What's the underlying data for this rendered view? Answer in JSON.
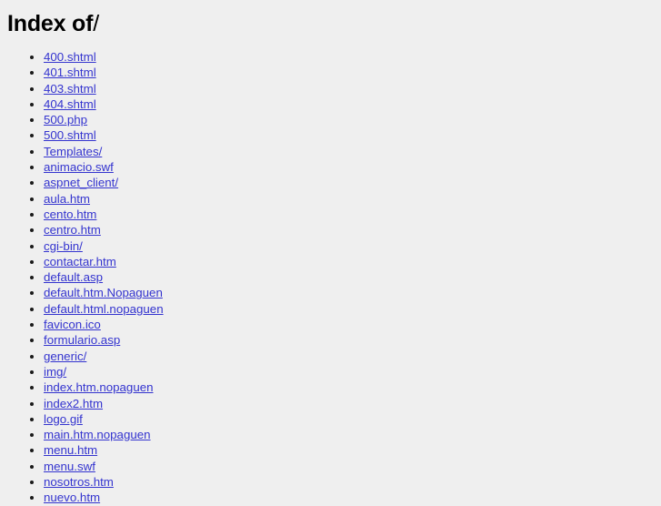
{
  "page": {
    "title_prefix": "Index of",
    "title_path": "/",
    "background_color": "#efefef",
    "link_color": "#3434cf",
    "text_color": "#000000"
  },
  "listing": {
    "entries": [
      {
        "label": "400.shtml"
      },
      {
        "label": "401.shtml"
      },
      {
        "label": "403.shtml"
      },
      {
        "label": "404.shtml"
      },
      {
        "label": "500.php"
      },
      {
        "label": "500.shtml"
      },
      {
        "label": "Templates/"
      },
      {
        "label": "animacio.swf"
      },
      {
        "label": "aspnet_client/"
      },
      {
        "label": "aula.htm"
      },
      {
        "label": "cento.htm"
      },
      {
        "label": "centro.htm"
      },
      {
        "label": "cgi-bin/"
      },
      {
        "label": "contactar.htm"
      },
      {
        "label": "default.asp"
      },
      {
        "label": "default.htm.Nopaguen"
      },
      {
        "label": "default.html.nopaguen"
      },
      {
        "label": "favicon.ico"
      },
      {
        "label": "formulario.asp"
      },
      {
        "label": "generic/"
      },
      {
        "label": "img/"
      },
      {
        "label": "index.htm.nopaguen"
      },
      {
        "label": "index2.htm"
      },
      {
        "label": "logo.gif"
      },
      {
        "label": "main.htm.nopaguen"
      },
      {
        "label": "menu.htm"
      },
      {
        "label": "menu.swf"
      },
      {
        "label": "nosotros.htm"
      },
      {
        "label": "nuevo.htm"
      }
    ]
  }
}
